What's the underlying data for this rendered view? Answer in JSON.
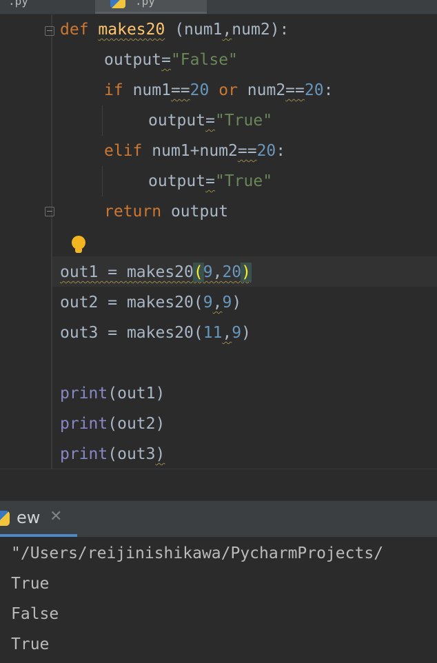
{
  "tabs": [
    {
      "label": ".py"
    },
    {
      "label": ".py"
    }
  ],
  "code": {
    "def_kw": "def",
    "fn_name": "makes20",
    "p_open": " (",
    "param1": "num1",
    "comma": ",",
    "param2": "num2",
    "p_close": "):",
    "output_var": "output",
    "eq": "=",
    "str_false": "\"False\"",
    "if_kw": "if",
    "num1": "num1",
    "eqeq": "==",
    "n20": "20",
    "or_kw": "or",
    "num2": "num2",
    "colon": ":",
    "str_true": "\"True\"",
    "elif_kw": "elif",
    "sum_expr": "num1+num2",
    "return_kw": "return",
    "out1": "out1",
    "out2": "out2",
    "out3": "out3",
    "assign": " = ",
    "call_open": "(",
    "call_close": ")",
    "n9": "9",
    "n11": "11",
    "print_fn": "print"
  },
  "run_panel": {
    "tab_label": "ew",
    "close_glyph": "✕"
  },
  "console": {
    "path_line": "\"/Users/reijinishikawa/PycharmProjects/",
    "outputs": [
      "True",
      "False",
      "True"
    ]
  }
}
